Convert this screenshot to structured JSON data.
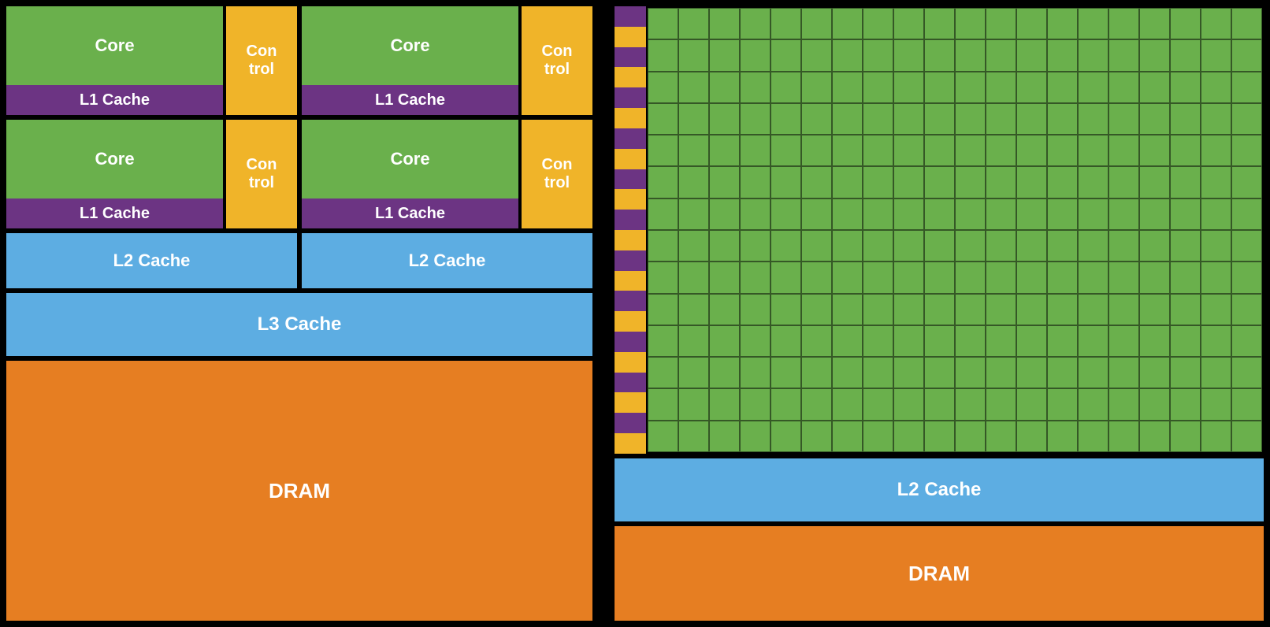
{
  "left": {
    "core_top_left": "Core",
    "core_top_right": "Core",
    "core_bottom_left": "Core",
    "core_bottom_right": "Core",
    "control_label": "Con\ntrol",
    "l1_cache_label": "L1 Cache",
    "l2_cache_label": "L2 Cache",
    "l3_cache_label": "L3 Cache",
    "dram_label": "DRAM"
  },
  "right": {
    "l2_cache_label": "L2 Cache",
    "dram_label": "DRAM"
  },
  "colors": {
    "green": "#6ab04c",
    "purple": "#6c3483",
    "yellow": "#f0b429",
    "blue": "#5dade2",
    "orange": "#e67e22",
    "black": "#000000"
  }
}
